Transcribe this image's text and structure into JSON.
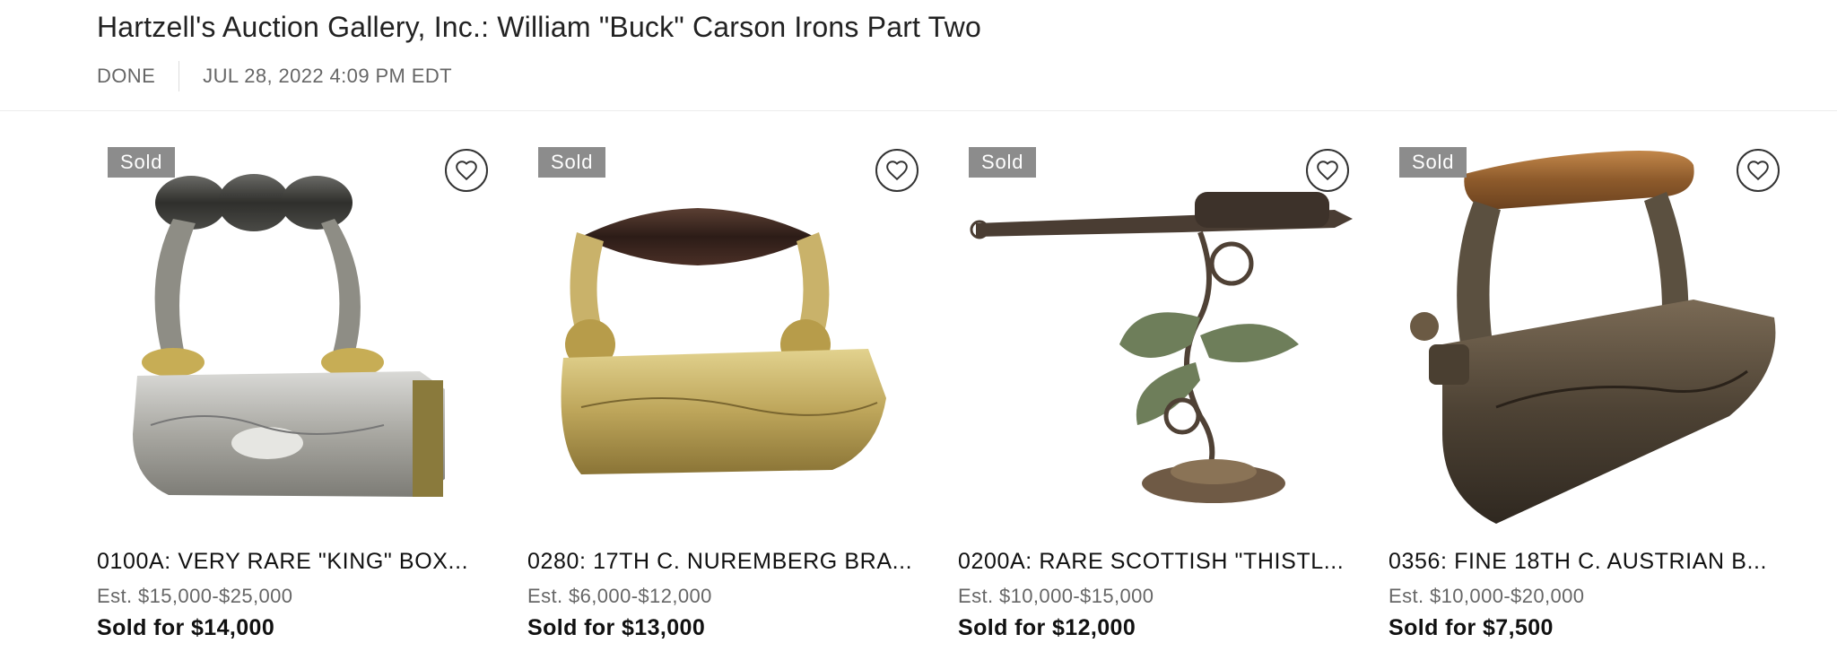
{
  "header": {
    "title": "Hartzell's Auction Gallery, Inc.: William \"Buck\" Carson Irons Part Two",
    "status": "DONE",
    "datetime": "JUL 28, 2022 4:09 PM EDT"
  },
  "lots": [
    {
      "badge": "Sold",
      "title": "0100A: VERY RARE \"KING\" BOX...",
      "estimate": "Est. $15,000-$25,000",
      "sold": "Sold for $14,000",
      "image_icon": "silver-box-iron-image"
    },
    {
      "badge": "Sold",
      "title": "0280: 17TH C. NUREMBERG BRA...",
      "estimate": "Est. $6,000-$12,000",
      "sold": "Sold for $13,000",
      "image_icon": "brass-iron-image"
    },
    {
      "badge": "Sold",
      "title": "0200A: RARE SCOTTISH \"THISTL...",
      "estimate": "Est. $10,000-$15,000",
      "sold": "Sold for $12,000",
      "image_icon": "thistle-iron-stand-image"
    },
    {
      "badge": "Sold",
      "title": "0356: FINE 18TH C. AUSTRIAN B...",
      "estimate": "Est. $10,000-$20,000",
      "sold": "Sold for $7,500",
      "image_icon": "austrian-box-iron-image"
    }
  ],
  "colors": {
    "badge_bg": "#8c8c8c",
    "text_primary": "#111111",
    "text_secondary": "#666666"
  }
}
